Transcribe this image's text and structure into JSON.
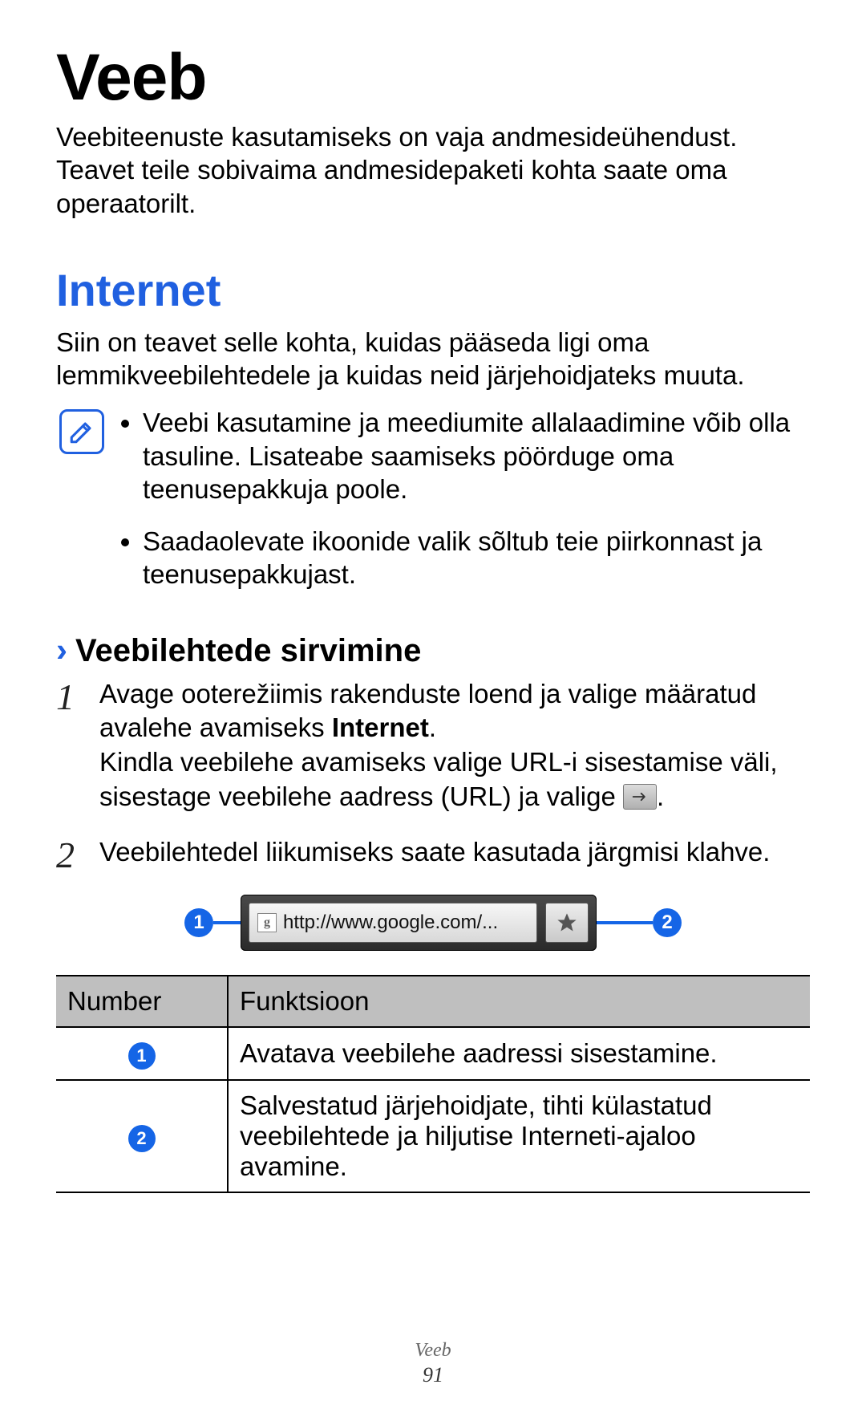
{
  "page": {
    "title": "Veeb",
    "intro": "Veebiteenuste kasutamiseks on vaja andmesideühendust. Teavet teile sobivaima andmesidepaketi kohta saate oma operaatorilt.",
    "footer_title": "Veeb",
    "footer_page": "91"
  },
  "section": {
    "title": "Internet",
    "intro": "Siin on teavet selle kohta, kuidas pääseda ligi oma lemmikveebilehtedele ja kuidas neid järjehoidjateks muuta.",
    "notes": [
      "Veebi kasutamine ja meediumite allalaadimine võib olla tasuline. Lisateabe saamiseks pöörduge oma teenusepakkuja poole.",
      "Saadaolevate ikoonide valik sõltub teie piirkonnast ja teenusepakkujast."
    ]
  },
  "subsection": {
    "chevron": "›",
    "title": "Veebilehtede sirvimine",
    "steps": {
      "1": {
        "num": "1",
        "line1a": "Avage ooterežiimis rakenduste loend ja valige määratud avalehe avamiseks ",
        "line1b": "Internet",
        "line1c": ".",
        "line2": "Kindla veebilehe avamiseks valige URL-i sisestamise väli, sisestage veebilehe aadress (URL) ja valige ",
        "line2end": "."
      },
      "2": {
        "num": "2",
        "body": "Veebilehtedel liikumiseks saate kasutada järgmisi klahve."
      }
    },
    "browser": {
      "url": "http://www.google.com/...",
      "callout_left": "1",
      "callout_right": "2"
    }
  },
  "table": {
    "head_number": "Number",
    "head_function": "Funktsioon",
    "rows": [
      {
        "num": "1",
        "desc": "Avatava veebilehe aadressi sisestamine."
      },
      {
        "num": "2",
        "desc": "Salvestatud järjehoidjate, tihti külastatud veebilehtede ja hiljutise Interneti-ajaloo avamine."
      }
    ]
  }
}
